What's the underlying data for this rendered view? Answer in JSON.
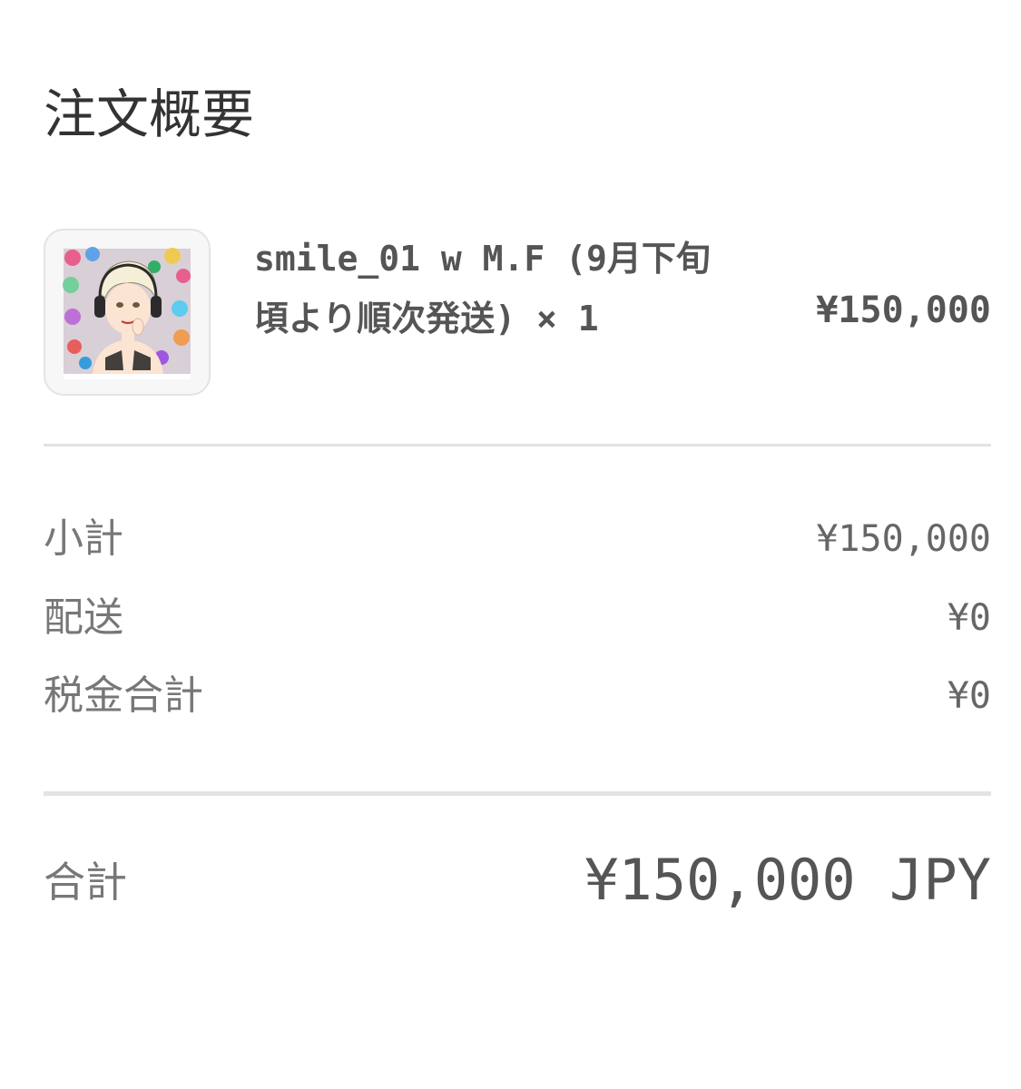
{
  "summary": {
    "title": "注文概要"
  },
  "item": {
    "name": "smile_01 w M.F (9月下旬頃より順次発送) × 1",
    "price": "¥150,000",
    "thumbnail": "artwork-thumbnail"
  },
  "costs": {
    "subtotal_label": "小計",
    "subtotal_value": "¥150,000",
    "shipping_label": "配送",
    "shipping_value": "¥0",
    "tax_label": "税金合計",
    "tax_value": "¥0"
  },
  "total": {
    "label": "合計",
    "value": "¥150,000 JPY"
  },
  "colors": {
    "text_dark": "#333333",
    "text_muted": "#777777",
    "divider": "#e3e3e3"
  }
}
